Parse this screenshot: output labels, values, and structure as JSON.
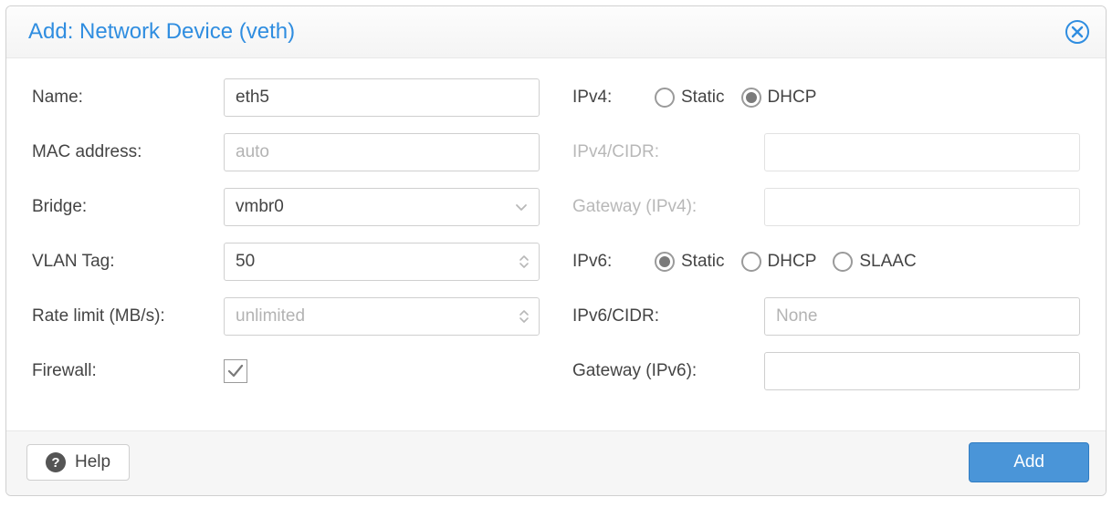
{
  "header": {
    "title": "Add: Network Device (veth)"
  },
  "left": {
    "name_label": "Name:",
    "name_value": "eth5",
    "mac_label": "MAC address:",
    "mac_placeholder": "auto",
    "mac_value": "",
    "bridge_label": "Bridge:",
    "bridge_value": "vmbr0",
    "vlan_label": "VLAN Tag:",
    "vlan_value": "50",
    "rate_label": "Rate limit (MB/s):",
    "rate_placeholder": "unlimited",
    "rate_value": "",
    "firewall_label": "Firewall:",
    "firewall_checked": true
  },
  "right": {
    "ipv4_label": "IPv4:",
    "ipv4_options": [
      "Static",
      "DHCP"
    ],
    "ipv4_selected": "DHCP",
    "ipv4cidr_label": "IPv4/CIDR:",
    "ipv4cidr_value": "",
    "gw4_label": "Gateway (IPv4):",
    "gw4_value": "",
    "ipv6_label": "IPv6:",
    "ipv6_options": [
      "Static",
      "DHCP",
      "SLAAC"
    ],
    "ipv6_selected": "Static",
    "ipv6cidr_label": "IPv6/CIDR:",
    "ipv6cidr_placeholder": "None",
    "ipv6cidr_value": "",
    "gw6_label": "Gateway (IPv6):",
    "gw6_value": ""
  },
  "footer": {
    "help_label": "Help",
    "add_label": "Add"
  }
}
